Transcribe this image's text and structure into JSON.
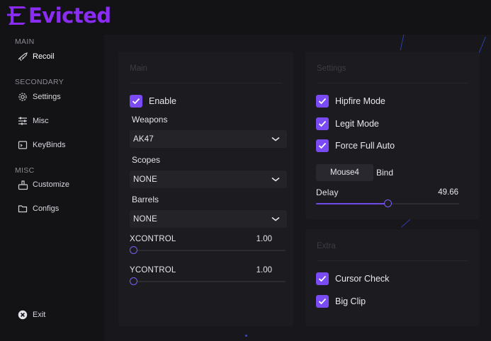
{
  "app": {
    "title": "Evicted",
    "brand_color": "#8b2cf5",
    "accent": "#7a4bf3"
  },
  "sidebar": {
    "sections": [
      {
        "label": "MAIN",
        "items": [
          {
            "label": "Recoil",
            "icon": "gun-icon",
            "active": true
          }
        ]
      },
      {
        "label": "SECONDARY",
        "items": [
          {
            "label": "Settings",
            "icon": "gear-icon"
          },
          {
            "label": "Misc",
            "icon": "sliders-icon"
          },
          {
            "label": "KeyBinds",
            "icon": "keyboard-icon"
          }
        ]
      },
      {
        "label": "MISC",
        "items": [
          {
            "label": "Customize",
            "icon": "brush-icon"
          },
          {
            "label": "Configs",
            "icon": "folder-icon"
          }
        ]
      }
    ],
    "exit_label": "Exit"
  },
  "main_panel": {
    "title": "Main",
    "enable": {
      "label": "Enable",
      "checked": true
    },
    "weapons": {
      "label": "Weapons",
      "value": "AK47"
    },
    "scopes": {
      "label": "Scopes",
      "value": "NONE"
    },
    "barrels": {
      "label": "Barrels",
      "value": "NONE"
    },
    "xcontrol": {
      "label": "XCONTROL",
      "value": "1.00",
      "fraction": 0.0
    },
    "ycontrol": {
      "label": "YCONTROL",
      "value": "1.00",
      "fraction": 0.0
    }
  },
  "settings_panel": {
    "title": "Settings",
    "hipfire": {
      "label": "Hipfire Mode",
      "checked": true
    },
    "legit": {
      "label": "Legit Mode",
      "checked": true
    },
    "force_full_auto": {
      "label": "Force Full Auto",
      "checked": true
    },
    "bind_key": "Mouse4",
    "bind_label": "Bind",
    "delay": {
      "label": "Delay",
      "value": "49.66",
      "fraction": 0.5
    }
  },
  "extra_panel": {
    "title": "Extra",
    "cursor_check": {
      "label": "Cursor Check",
      "checked": true
    },
    "big_clip": {
      "label": "Big Clip",
      "checked": true
    }
  }
}
